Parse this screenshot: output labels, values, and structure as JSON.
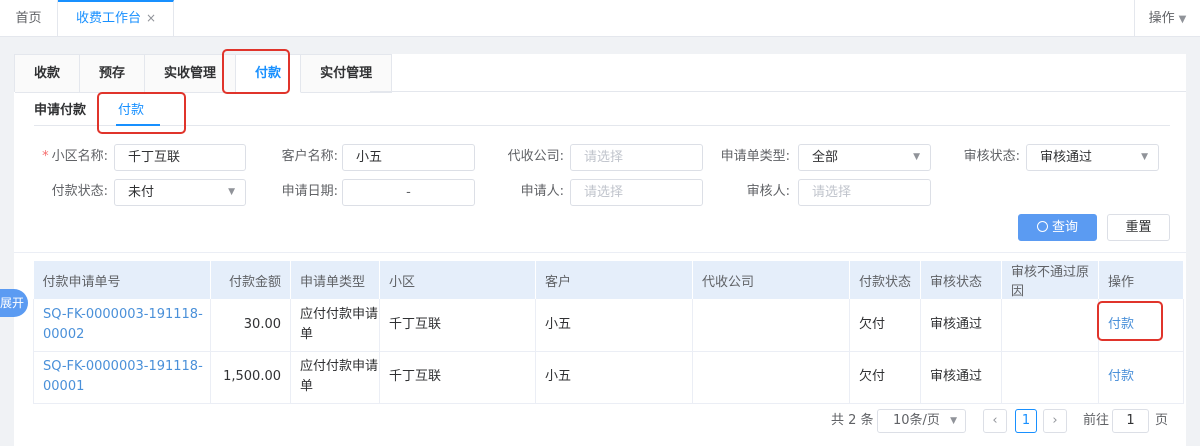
{
  "top_tabs": {
    "home": "首页",
    "active": "收费工作台",
    "close": "×",
    "ops_menu": "操作"
  },
  "main_tabs": [
    "收款",
    "预存",
    "实收管理",
    "付款",
    "实付管理"
  ],
  "sub_tabs": [
    "申请付款",
    "付款"
  ],
  "filters": {
    "community_label": "小区名称:",
    "community_required": "*",
    "community_value": "千丁互联",
    "customer_label": "客户名称:",
    "customer_value": "小五",
    "collector_label": "代收公司:",
    "collector_placeholder": "请选择",
    "app_type_label": "申请单类型:",
    "app_type_value": "全部",
    "audit_status_label": "审核状态:",
    "audit_status_value": "审核通过",
    "pay_status_label": "付款状态:",
    "pay_status_value": "未付",
    "apply_date_label": "申请日期:",
    "apply_date_sep": "-",
    "applicant_label": "申请人:",
    "applicant_placeholder": "请选择",
    "auditor_label": "审核人:",
    "auditor_placeholder": "请选择"
  },
  "buttons": {
    "search": "查询",
    "reset": "重置"
  },
  "side_toggle": "展开",
  "table": {
    "headers": [
      "付款申请单号",
      "付款金额",
      "申请单类型",
      "小区",
      "客户",
      "代收公司",
      "付款状态",
      "审核状态",
      "审核不通过原因",
      "操作"
    ],
    "rows": [
      {
        "id": "SQ-FK-0000003-191118-00002",
        "amount": "30.00",
        "type": "应付付款申请单",
        "community": "千丁互联",
        "customer": "小五",
        "collector": "",
        "pay_status": "欠付",
        "audit_status": "审核通过",
        "reject_reason": "",
        "action": "付款"
      },
      {
        "id": "SQ-FK-0000003-191118-00001",
        "amount": "1,500.00",
        "type": "应付付款申请单",
        "community": "千丁互联",
        "customer": "小五",
        "collector": "",
        "pay_status": "欠付",
        "audit_status": "审核通过",
        "reject_reason": "",
        "action": "付款"
      }
    ]
  },
  "pagination": {
    "total": "共 2 条",
    "page_size": "10条/页",
    "current_page": "1",
    "goto_label": "前往",
    "goto_value": "1",
    "page_suffix": "页"
  },
  "colors": {
    "accent": "#1890ff",
    "highlight_box": "#e0342b",
    "table_header": "#e5eefa"
  }
}
